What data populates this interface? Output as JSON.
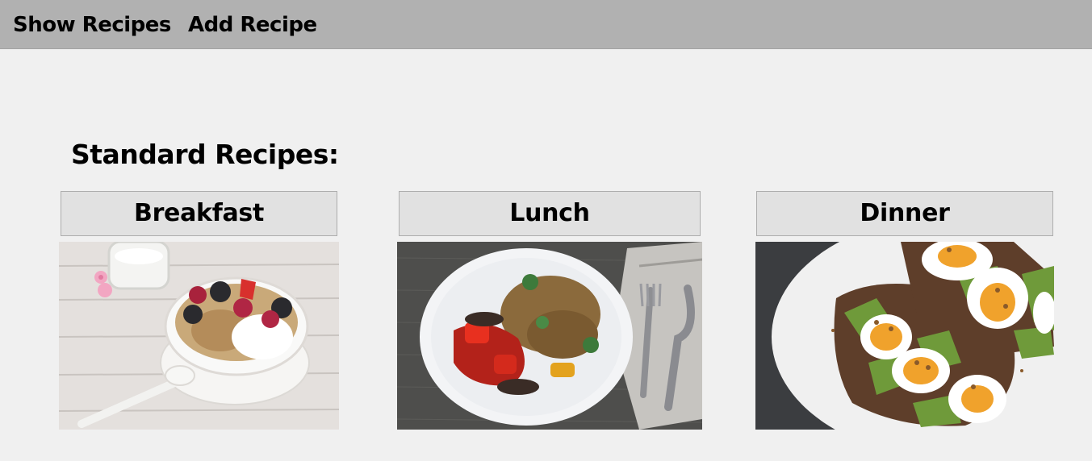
{
  "menu": {
    "show_recipes": "Show Recipes",
    "add_recipe": "Add Recipe"
  },
  "main": {
    "heading": "Standard Recipes:",
    "categories": [
      {
        "label": "Breakfast",
        "image": "yogurt-berries-granola-bowl"
      },
      {
        "label": "Lunch",
        "image": "roasted-vegetables-plate"
      },
      {
        "label": "Dinner",
        "image": "avocado-egg-toast"
      }
    ]
  }
}
